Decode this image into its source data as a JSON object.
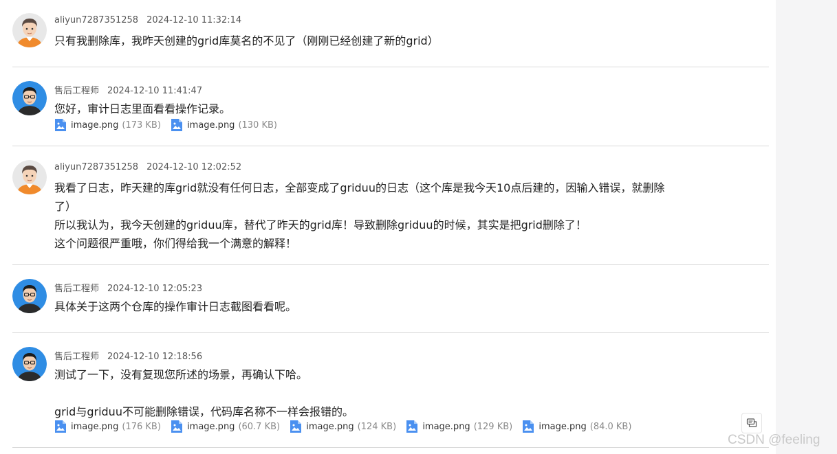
{
  "messages": [
    {
      "user": "aliyun7287351258",
      "time": "2024-12-10 11:32:14",
      "avatar": "customer-avatar-icon",
      "lines": [
        "只有我删除库，我昨天创建的grid库莫名的不见了（刚刚已经创建了新的grid）"
      ],
      "attachments": []
    },
    {
      "user": "售后工程师",
      "time": "2024-12-10 11:41:47",
      "avatar": "engineer-avatar-icon",
      "lines": [
        "您好，审计日志里面看看操作记录。"
      ],
      "attachments": [
        {
          "name": "image.png",
          "size": "(173 KB)"
        },
        {
          "name": "image.png",
          "size": "(130 KB)"
        }
      ]
    },
    {
      "user": "aliyun7287351258",
      "time": "2024-12-10 12:02:52",
      "avatar": "customer-avatar-icon",
      "lines": [
        "我看了日志，昨天建的库grid就没有任何日志，全部变成了griduu的日志（这个库是我今天10点后建的，因输入错误，就删除",
        "了）",
        "所以我认为，我今天创建的griduu库，替代了昨天的grid库！导致删除griduu的时候，其实是把grid删除了！",
        "这个问题很严重哦，你们得给我一个满意的解释！"
      ],
      "attachments": []
    },
    {
      "user": "售后工程师",
      "time": "2024-12-10 12:05:23",
      "avatar": "engineer-avatar-icon",
      "lines": [
        "具体关于这两个仓库的操作审计日志截图看看呢。"
      ],
      "attachments": []
    },
    {
      "user": "售后工程师",
      "time": "2024-12-10 12:18:56",
      "avatar": "engineer-avatar-icon",
      "lines": [
        "测试了一下，没有复现您所述的场景，再确认下哈。",
        "",
        "grid与griduu不可能删除错误，代码库名称不一样会报错的。"
      ],
      "attachments": [
        {
          "name": "image.png",
          "size": "(176 KB)"
        },
        {
          "name": "image.png",
          "size": "(60.7 KB)"
        },
        {
          "name": "image.png",
          "size": "(124 KB)"
        },
        {
          "name": "image.png",
          "size": "(129 KB)"
        },
        {
          "name": "image.png",
          "size": "(84.0 KB)"
        }
      ]
    }
  ],
  "watermark": "CSDN @feeling",
  "colors": {
    "divider": "#d9d9d9",
    "meta_text": "#555555",
    "size_text": "#8a8a8a",
    "image_icon": "#4a90f0",
    "customer_shirt": "#f08a2c",
    "engineer_bg": "#2f8de4"
  },
  "icons": {
    "attachment": "image-file-icon",
    "floating": "chat-bubble-icon"
  }
}
